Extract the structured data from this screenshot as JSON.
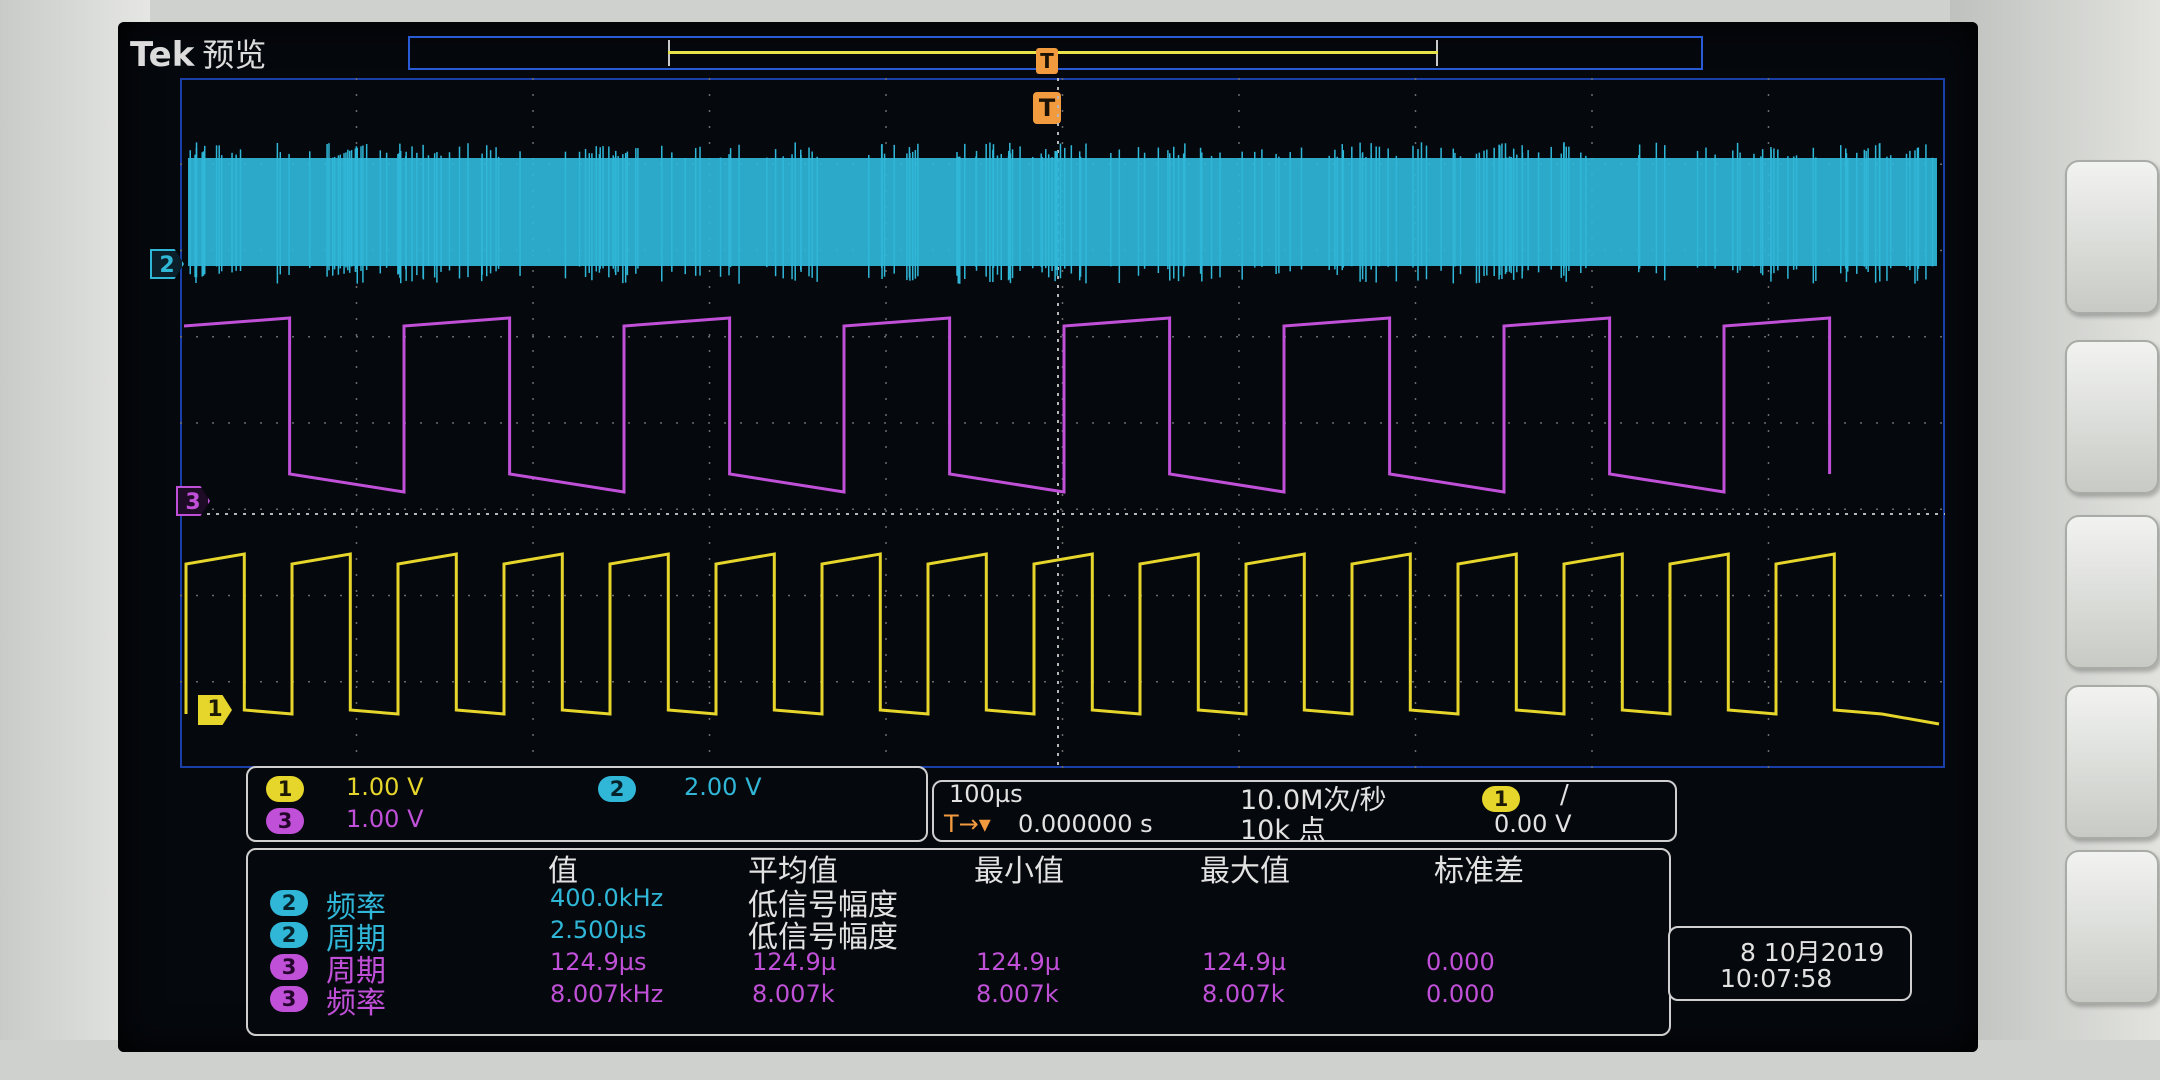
{
  "brand": {
    "name": "Tek",
    "mode": "预览"
  },
  "colors": {
    "ch1": "#e6d52a",
    "ch2": "#30b7d8",
    "ch3": "#c050d8",
    "trigger": "#f19a3e",
    "graticule": "#1a3fa8"
  },
  "trigger_marker": "T",
  "channel_markers": {
    "ch1": "1",
    "ch2": "2",
    "ch3": "3"
  },
  "vertical": [
    {
      "channel": "1",
      "scale": "1.00 V"
    },
    {
      "channel": "2",
      "scale": "2.00 V"
    },
    {
      "channel": "3",
      "scale": "1.00 V"
    }
  ],
  "horizontal": {
    "timebase": "100µs",
    "sample_rate": "10.0M次/秒",
    "trigger_position_symbol": "T→▾",
    "trigger_position": "0.000000 s",
    "record_length": "10k 点",
    "trigger_source": "1",
    "trigger_slope_icon": "rising-edge-icon",
    "trigger_slope_glyph": "∕",
    "trigger_level": "0.00 V"
  },
  "measurements": {
    "headers": [
      "值",
      "平均值",
      "最小值",
      "最大值",
      "标准差"
    ],
    "rows": [
      {
        "channel": "2",
        "name": "频率",
        "value": "400.0kHz",
        "mean": "低信号幅度",
        "min": "",
        "max": "",
        "std": ""
      },
      {
        "channel": "2",
        "name": "周期",
        "value": "2.500µs",
        "mean": "低信号幅度",
        "min": "",
        "max": "",
        "std": ""
      },
      {
        "channel": "3",
        "name": "周期",
        "value": "124.9µs",
        "mean": "124.9µ",
        "min": "124.9µ",
        "max": "124.9µ",
        "std": "0.000"
      },
      {
        "channel": "3",
        "name": "频率",
        "value": "8.007kHz",
        "mean": "8.007k",
        "min": "8.007k",
        "max": "8.007k",
        "std": "0.000"
      }
    ]
  },
  "clock": {
    "date": "8 10月2019",
    "time": "10:07:58"
  }
}
